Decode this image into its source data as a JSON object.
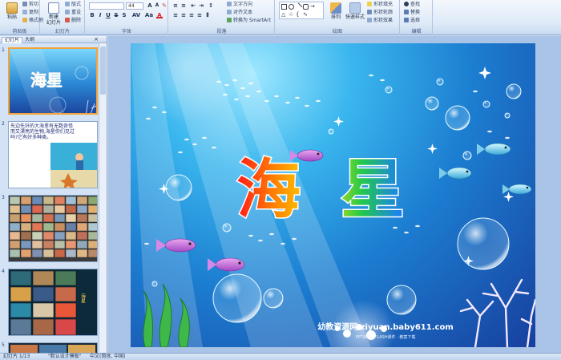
{
  "ribbon": {
    "clipboard": {
      "label": "剪贴板",
      "paste": "粘贴",
      "cut": "剪切",
      "copy": "复制",
      "format_painter": "格式刷"
    },
    "slides": {
      "label": "幻灯片",
      "new_slide": "新建\n幻灯片",
      "layout": "版式",
      "reset": "重设",
      "delete": "删除"
    },
    "font": {
      "label": "字体",
      "size": "44"
    },
    "paragraph": {
      "label": "段落",
      "text_direction": "文字方向",
      "align_text": "对齐文本",
      "smartart": "转换为 SmartArt"
    },
    "drawing": {
      "label": "绘图",
      "arrange": "排列",
      "quick_styles": "快速样式",
      "shape_fill": "形状填充",
      "shape_outline": "形状轮廓",
      "shape_effects": "形状效果"
    },
    "editing": {
      "label": "编辑",
      "find": "查找",
      "replace": "替换",
      "select": "选择"
    }
  },
  "panel": {
    "tab_slides": "幻灯片",
    "tab_outline": "大纲",
    "close": "×",
    "thumbs": [
      {
        "num": "1",
        "title": "海星"
      },
      {
        "num": "2",
        "text": "先边先钎的大海里有无数奇怪而又漂亮的生物,海星你们见过吗?它有好多种类。"
      },
      {
        "num": "3"
      },
      {
        "num": "4",
        "side": "海星"
      },
      {
        "num": "5"
      }
    ]
  },
  "slide": {
    "title": "海星",
    "watermark": "幼教资源网 ziyuan.baby611.com",
    "watermark_sub": "PPT课件 · FLASH课件 · 教案下载",
    "colors": {
      "sea_top": "#9fe8ff",
      "sea_mid": "#1c7ed1",
      "sea_deep": "#173f9e"
    }
  },
  "status": {
    "slide_counter": "幻灯片 1/13",
    "theme": "\"默认设计模板\"",
    "language": "中文(简体, 中国)"
  }
}
